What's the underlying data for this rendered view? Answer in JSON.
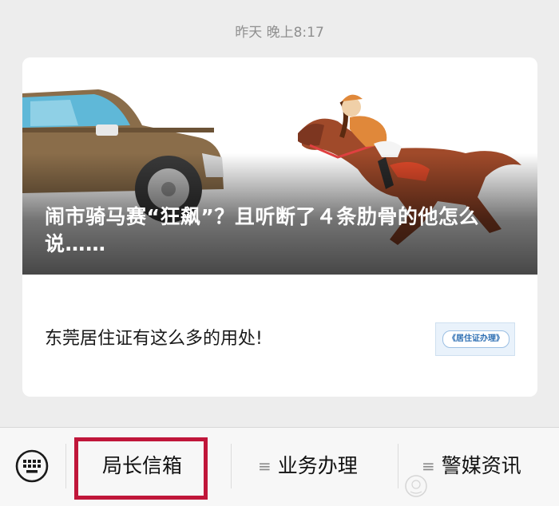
{
  "timestamp": "昨天 晚上8:17",
  "article": {
    "main_title": "闹市骑马赛“狂飙”？且听断了４条肋骨的他怎么说……",
    "sub_title": "东莞居住证有这么多的用处!",
    "thumb_text": "《居住证办理》"
  },
  "bottom_menu": {
    "items": [
      {
        "label": "局长信箱",
        "has_submenu": false
      },
      {
        "label": "业务办理",
        "has_submenu": true
      },
      {
        "label": "警媒资讯",
        "has_submenu": true
      }
    ],
    "submenu_glyph": "≡",
    "highlighted_item": "局长信箱"
  },
  "colors": {
    "background": "#ededed",
    "highlight": "#c0163a",
    "car_body": "#8a6d4a",
    "horse": "#a04a2a",
    "jockey": "#e0883a"
  }
}
